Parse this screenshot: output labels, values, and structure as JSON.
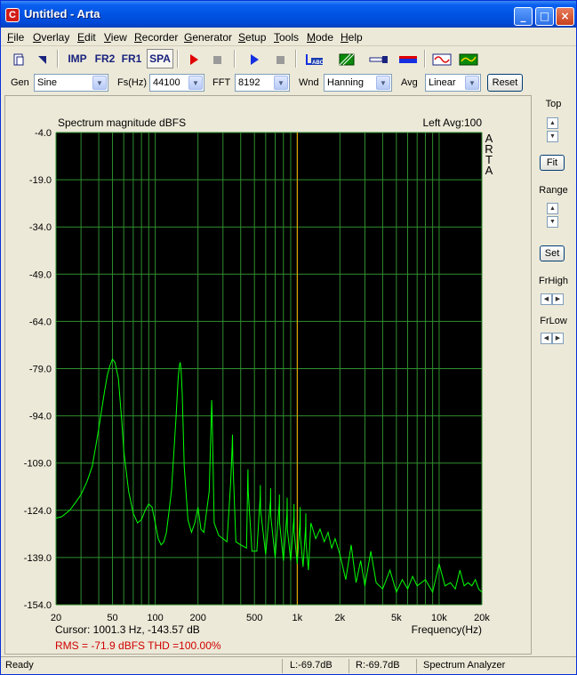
{
  "window": {
    "title": "Untitled - Arta",
    "icon_glyph": "C",
    "controls": {
      "minimize": "_",
      "maximize": "□",
      "close": "×"
    }
  },
  "menu": [
    {
      "label": "File",
      "key": "F",
      "rest": "ile"
    },
    {
      "label": "Overlay",
      "key": "O",
      "rest": "verlay"
    },
    {
      "label": "Edit",
      "key": "E",
      "rest": "dit"
    },
    {
      "label": "View",
      "key": "V",
      "rest": "iew"
    },
    {
      "label": "Recorder",
      "key": "R",
      "rest": "ecorder"
    },
    {
      "label": "Generator",
      "key": "G",
      "rest": "enerator"
    },
    {
      "label": "Setup",
      "key": "S",
      "rest": "etup"
    },
    {
      "label": "Tools",
      "key": "T",
      "rest": "ools"
    },
    {
      "label": "Mode",
      "key": "M",
      "rest": "ode"
    },
    {
      "label": "Help",
      "key": "H",
      "rest": "elp"
    }
  ],
  "toolbar": {
    "imp": "IMP",
    "fr2": "FR2",
    "fr1": "FR1",
    "spa": "SPA",
    "abc": "ABC",
    "icons": [
      "new-file-icon",
      "open-icon",
      "record-red-icon",
      "stop-icon",
      "play-blue-icon",
      "stop2-icon",
      "export-abc-icon",
      "hatch-icon",
      "mic-icon",
      "rgb-icon",
      "sine-wave-icon",
      "green-wave-icon"
    ]
  },
  "controls": {
    "gen_label": "Gen",
    "gen_value": "Sine",
    "fs_label": "Fs(Hz)",
    "fs_value": "44100",
    "fft_label": "FFT",
    "fft_value": "8192",
    "wnd_label": "Wnd",
    "wnd_value": "Hanning",
    "avg_label": "Avg",
    "avg_value": "Linear",
    "reset_label": "Reset"
  },
  "plot": {
    "title": "Spectrum magnitude dBFS",
    "top_right": "Left  Avg:100",
    "brand_letters": [
      "A",
      "R",
      "T",
      "A"
    ],
    "cursor_text": "Cursor:  1001.3 Hz, -143.57 dB",
    "rms_text": "RMS =  -71.9 dBFS    THD =100.00%",
    "freq_label": "Frequency(Hz)",
    "colors": {
      "background": "#000000",
      "grid": "#2f8f2f",
      "trace": "#00ff00",
      "cursor": "#ffb000",
      "info": "#d00000"
    }
  },
  "chart_data": {
    "type": "line",
    "title": "Spectrum magnitude dBFS",
    "xlabel": "Frequency(Hz)",
    "ylabel": "",
    "x_scale": "log",
    "xlim": [
      20,
      20000
    ],
    "ylim": [
      -154,
      -4
    ],
    "x_ticks": [
      {
        "v": 20,
        "l": "20"
      },
      {
        "v": 50,
        "l": "50"
      },
      {
        "v": 100,
        "l": "100"
      },
      {
        "v": 200,
        "l": "200"
      },
      {
        "v": 500,
        "l": "500"
      },
      {
        "v": 1000,
        "l": "1k"
      },
      {
        "v": 2000,
        "l": "2k"
      },
      {
        "v": 5000,
        "l": "5k"
      },
      {
        "v": 10000,
        "l": "10k"
      },
      {
        "v": 20000,
        "l": "20k"
      }
    ],
    "y_ticks": [
      "-4.0",
      "-19.0",
      "-34.0",
      "-49.0",
      "-64.0",
      "-79.0",
      "-94.0",
      "-109.0",
      "-124.0",
      "-139.0",
      "-154.0"
    ],
    "cursor_x": 1001.3,
    "series": [
      {
        "x": [
          20,
          22,
          25,
          28,
          30,
          33,
          36,
          38,
          40,
          42,
          44,
          46,
          48,
          50,
          52,
          55,
          58,
          60,
          65,
          70,
          75,
          80,
          85,
          90,
          95,
          100,
          105,
          110,
          115,
          120,
          130,
          140,
          145,
          148,
          150,
          152,
          155,
          160,
          170,
          180,
          190,
          200,
          210,
          220,
          240,
          248,
          250,
          252,
          260,
          280,
          300,
          320,
          340,
          348,
          350,
          352,
          370,
          400,
          440,
          448,
          450,
          452,
          480,
          520,
          548,
          550,
          552,
          600,
          648,
          650,
          652,
          700,
          748,
          750,
          752,
          800,
          848,
          850,
          852,
          900,
          948,
          950,
          952,
          1000,
          1048,
          1050,
          1052,
          1100,
          1148,
          1150,
          1152,
          1200,
          1250,
          1350,
          1450,
          1550,
          1650,
          1750,
          1850,
          2000,
          2200,
          2400,
          2600,
          2800,
          3000,
          3300,
          3600,
          4000,
          4500,
          5000,
          5500,
          6000,
          6500,
          7000,
          8000,
          9000,
          10000,
          11000,
          12000,
          13000,
          14000,
          15000,
          16000,
          17000,
          18000,
          19000,
          20000
        ],
        "y": [
          -126.5,
          -126,
          -124,
          -121,
          -119,
          -115,
          -110,
          -104,
          -98,
          -92,
          -86,
          -81,
          -78,
          -76,
          -77,
          -82,
          -95,
          -105,
          -118,
          -125,
          -128,
          -127,
          -124,
          -122,
          -123,
          -128,
          -133,
          -135,
          -134,
          -131,
          -118,
          -95,
          -82,
          -78,
          -77,
          -79,
          -87,
          -110,
          -127,
          -131,
          -128,
          -123,
          -130,
          -131,
          -118,
          -95,
          -89,
          -95,
          -128,
          -132,
          -133,
          -134,
          -115,
          -104,
          -100,
          -108,
          -134,
          -135,
          -136,
          -115,
          -111,
          -118,
          -137,
          -137,
          -120,
          -116,
          -124,
          -138,
          -121,
          -117,
          -126,
          -139,
          -122,
          -119,
          -128,
          -140,
          -125,
          -120,
          -130,
          -140,
          -126,
          -122,
          -131,
          -141,
          -127,
          -123,
          -132,
          -142,
          -129,
          -125,
          -134,
          -143,
          -128,
          -133,
          -130,
          -134,
          -131,
          -136,
          -133,
          -138,
          -146,
          -135,
          -147,
          -140,
          -148,
          -137,
          -147,
          -149,
          -143,
          -150,
          -146,
          -149,
          -145,
          -148,
          -146,
          -150,
          -141,
          -148,
          -147,
          -149,
          -143,
          -148,
          -147,
          -148,
          -146,
          -149,
          -150
        ]
      }
    ]
  },
  "right_panel": {
    "top_label": "Top",
    "fit_label": "Fit",
    "range_label": "Range",
    "set_label": "Set",
    "frhigh_label": "FrHigh",
    "frlow_label": "FrLow"
  },
  "status": {
    "ready": "Ready",
    "left": "L:-69.7dB",
    "right": "R:-69.7dB",
    "mode": "Spectrum Analyzer"
  }
}
